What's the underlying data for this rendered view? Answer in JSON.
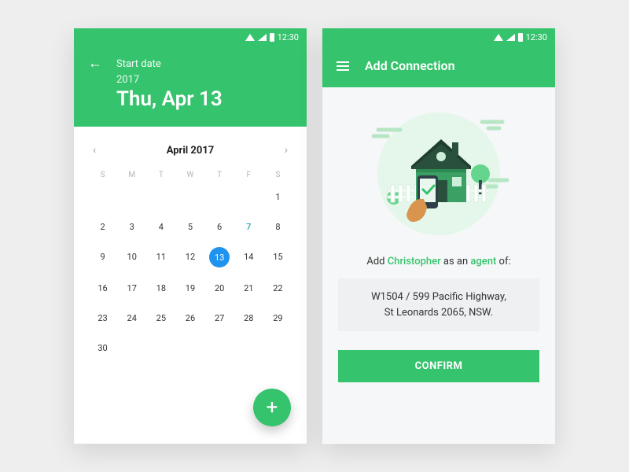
{
  "status": {
    "time": "12:30"
  },
  "calendar": {
    "start_label": "Start date",
    "year": "2017",
    "big_date": "Thu, Apr 13",
    "month_label": "April 2017",
    "dow": [
      "S",
      "M",
      "T",
      "W",
      "T",
      "F",
      "S"
    ],
    "selected_day": 13,
    "highlight_day": 7,
    "lead_blanks": 6,
    "last_day": 30
  },
  "connection": {
    "title": "Add Connection",
    "sentence_pre": "Add ",
    "name": "Christopher",
    "sentence_mid": " as an ",
    "role": "agent",
    "sentence_post": " of:",
    "address_l1": "W1504 / 599 Pacific Highway,",
    "address_l2": "St Leonards 2065, NSW.",
    "confirm": "CONFIRM"
  }
}
